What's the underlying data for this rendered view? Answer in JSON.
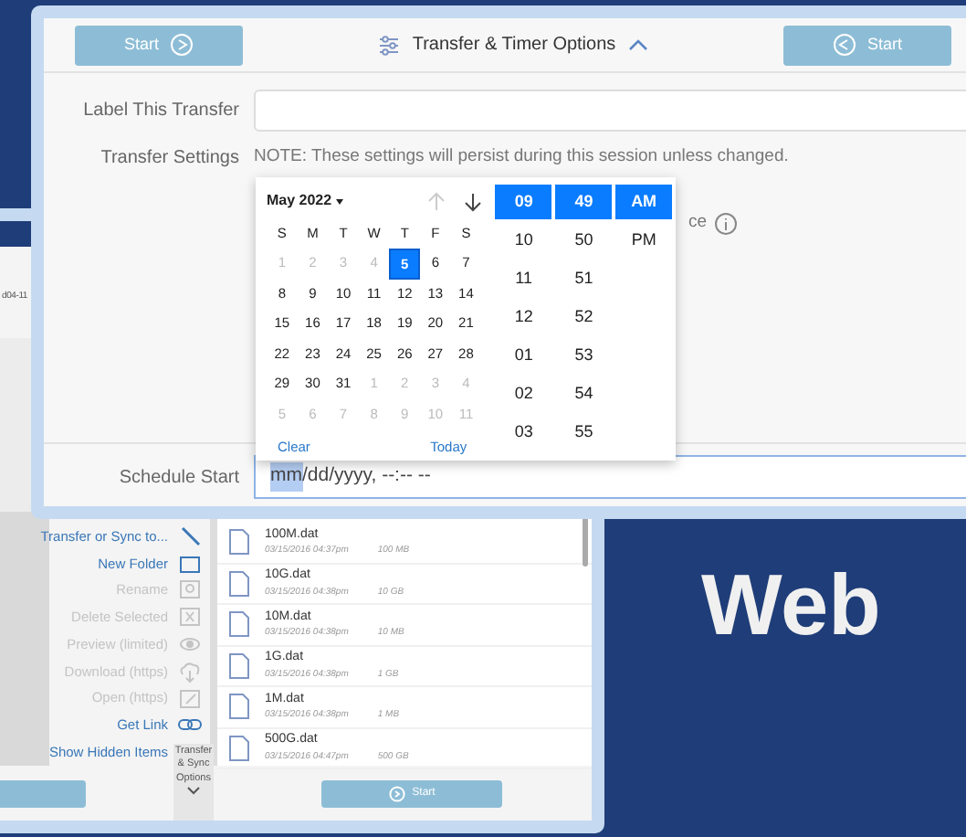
{
  "back_window": {
    "header_text": "d04-11",
    "actions": [
      {
        "label": "Transfer or Sync to...",
        "disabled": false,
        "kind": "transfer"
      },
      {
        "label": "New Folder",
        "disabled": false,
        "kind": "folder"
      },
      {
        "label": "Rename",
        "disabled": true,
        "kind": "rename"
      },
      {
        "label": "Delete Selected",
        "disabled": true,
        "kind": "delete"
      },
      {
        "label": "Preview (limited)",
        "disabled": true,
        "kind": "preview"
      },
      {
        "label": "Download (https)",
        "disabled": true,
        "kind": "download"
      },
      {
        "label": "Open (https)",
        "disabled": true,
        "kind": "open"
      },
      {
        "label": "Get Link",
        "disabled": false,
        "kind": "link"
      },
      {
        "label": "Show Hidden Items",
        "disabled": false,
        "kind": "none"
      }
    ],
    "files": [
      {
        "name": "100M.dat",
        "date": "03/15/2016 04:37pm",
        "size": "100 MB"
      },
      {
        "name": "10G.dat",
        "date": "03/15/2016 04:38pm",
        "size": "10 GB"
      },
      {
        "name": "10M.dat",
        "date": "03/15/2016 04:38pm",
        "size": "10 MB"
      },
      {
        "name": "1G.dat",
        "date": "03/15/2016 04:38pm",
        "size": "1 GB"
      },
      {
        "name": "1M.dat",
        "date": "03/15/2016 04:38pm",
        "size": "1 MB"
      },
      {
        "name": "500G.dat",
        "date": "03/15/2016 04:47pm",
        "size": "500 GB"
      }
    ],
    "options_tab": {
      "label": "Transfer & Sync Options",
      "expanded": false
    },
    "start_button": "Start"
  },
  "front_window": {
    "start_left": "Start",
    "title": "Transfer & Timer Options",
    "expanded": true,
    "start_right": "Start",
    "label_row": {
      "label": "Label This Transfer"
    },
    "settings_row": {
      "label": "Transfer Settings",
      "note": "NOTE: These settings will persist during this session unless changed.",
      "option_fragment": "ce"
    },
    "schedule_row": {
      "label": "Schedule Start",
      "value_segments": [
        {
          "text": "mm",
          "selected": true
        },
        {
          "text": "/dd/yyyy, --:-- --",
          "selected": false
        }
      ]
    }
  },
  "date_picker": {
    "month": "May 2022",
    "weekdays": [
      "S",
      "M",
      "T",
      "W",
      "T",
      "F",
      "S"
    ],
    "weeks": [
      [
        {
          "text": "1",
          "muted": true,
          "selected": false
        },
        {
          "text": "2",
          "muted": true,
          "selected": false
        },
        {
          "text": "3",
          "muted": true,
          "selected": false
        },
        {
          "text": "4",
          "muted": true,
          "selected": false
        },
        {
          "text": "5",
          "muted": false,
          "selected": true
        },
        {
          "text": "6",
          "muted": false,
          "selected": false
        },
        {
          "text": "7",
          "muted": false,
          "selected": false
        }
      ],
      [
        {
          "text": "8",
          "muted": false,
          "selected": false
        },
        {
          "text": "9",
          "muted": false,
          "selected": false
        },
        {
          "text": "10",
          "muted": false,
          "selected": false
        },
        {
          "text": "11",
          "muted": false,
          "selected": false
        },
        {
          "text": "12",
          "muted": false,
          "selected": false
        },
        {
          "text": "13",
          "muted": false,
          "selected": false
        },
        {
          "text": "14",
          "muted": false,
          "selected": false
        }
      ],
      [
        {
          "text": "15",
          "muted": false,
          "selected": false
        },
        {
          "text": "16",
          "muted": false,
          "selected": false
        },
        {
          "text": "17",
          "muted": false,
          "selected": false
        },
        {
          "text": "18",
          "muted": false,
          "selected": false
        },
        {
          "text": "19",
          "muted": false,
          "selected": false
        },
        {
          "text": "20",
          "muted": false,
          "selected": false
        },
        {
          "text": "21",
          "muted": false,
          "selected": false
        }
      ],
      [
        {
          "text": "22",
          "muted": false,
          "selected": false
        },
        {
          "text": "23",
          "muted": false,
          "selected": false
        },
        {
          "text": "24",
          "muted": false,
          "selected": false
        },
        {
          "text": "25",
          "muted": false,
          "selected": false
        },
        {
          "text": "26",
          "muted": false,
          "selected": false
        },
        {
          "text": "27",
          "muted": false,
          "selected": false
        },
        {
          "text": "28",
          "muted": false,
          "selected": false
        }
      ],
      [
        {
          "text": "29",
          "muted": false,
          "selected": false
        },
        {
          "text": "30",
          "muted": false,
          "selected": false
        },
        {
          "text": "31",
          "muted": false,
          "selected": false
        },
        {
          "text": "1",
          "muted": true,
          "selected": false
        },
        {
          "text": "2",
          "muted": true,
          "selected": false
        },
        {
          "text": "3",
          "muted": true,
          "selected": false
        },
        {
          "text": "4",
          "muted": true,
          "selected": false
        }
      ],
      [
        {
          "text": "5",
          "muted": true,
          "selected": false
        },
        {
          "text": "6",
          "muted": true,
          "selected": false
        },
        {
          "text": "7",
          "muted": true,
          "selected": false
        },
        {
          "text": "8",
          "muted": true,
          "selected": false
        },
        {
          "text": "9",
          "muted": true,
          "selected": false
        },
        {
          "text": "10",
          "muted": true,
          "selected": false
        },
        {
          "text": "11",
          "muted": true,
          "selected": false
        }
      ]
    ],
    "clear": "Clear",
    "today": "Today",
    "hours": [
      {
        "text": "09",
        "selected": true
      },
      {
        "text": "10",
        "selected": false
      },
      {
        "text": "11",
        "selected": false
      },
      {
        "text": "12",
        "selected": false
      },
      {
        "text": "01",
        "selected": false
      },
      {
        "text": "02",
        "selected": false
      },
      {
        "text": "03",
        "selected": false
      }
    ],
    "minutes": [
      {
        "text": "49",
        "selected": true
      },
      {
        "text": "50",
        "selected": false
      },
      {
        "text": "51",
        "selected": false
      },
      {
        "text": "52",
        "selected": false
      },
      {
        "text": "53",
        "selected": false
      },
      {
        "text": "54",
        "selected": false
      },
      {
        "text": "55",
        "selected": false
      }
    ],
    "periods": [
      {
        "text": "AM",
        "selected": true
      },
      {
        "text": "PM",
        "selected": false
      }
    ]
  },
  "caption": "Web"
}
